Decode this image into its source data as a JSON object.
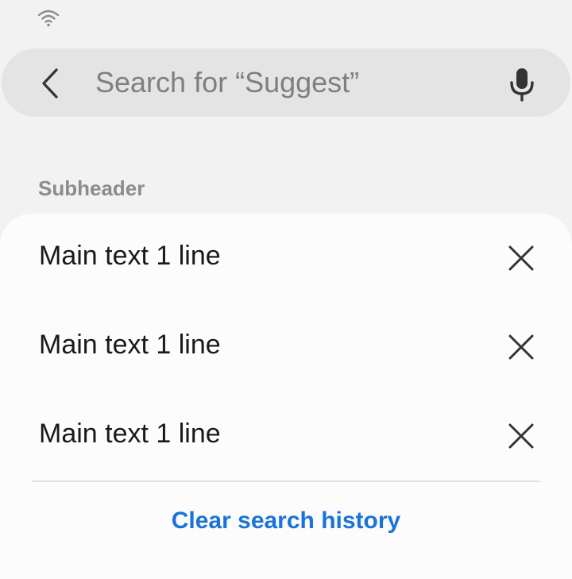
{
  "status_bar": {
    "icons": [
      "wifi-icon"
    ]
  },
  "search": {
    "placeholder": "Search for “Suggest”",
    "value": "",
    "back_icon": "chevron-left-icon",
    "mic_icon": "microphone-icon"
  },
  "subheader": "Subheader",
  "items": [
    {
      "label": "Main text 1 line",
      "action_icon": "close-icon"
    },
    {
      "label": "Main text 1 line",
      "action_icon": "close-icon"
    },
    {
      "label": "Main text 1 line",
      "action_icon": "close-icon"
    }
  ],
  "clear_history_label": "Clear search history",
  "colors": {
    "background": "#f2f2f2",
    "search_bar": "#e4e4e4",
    "card": "#fcfcfc",
    "accent": "#1a73d9",
    "subheader": "#8c8c8c"
  }
}
